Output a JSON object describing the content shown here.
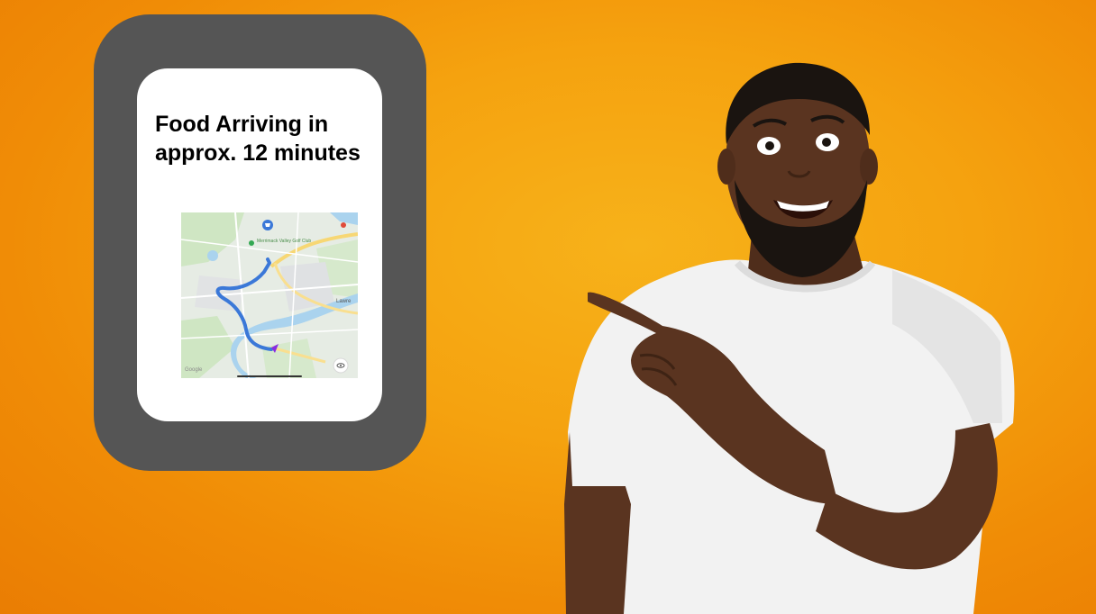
{
  "card": {
    "title": "Food Arriving in approx. 12 minutes"
  },
  "map": {
    "place_label": "Merrimack Valley Golf Club",
    "town_label": "Lawre",
    "watermark": "Google",
    "route_color": "#3b78d8",
    "vehicle_color": "#8a2be2"
  },
  "colors": {
    "background": "#f5a20f",
    "phone_frame": "#555555",
    "phone_screen": "#ffffff",
    "shirt": "#f2f2f2",
    "skin": "#5a3420"
  },
  "icons": {
    "vehicle": "delivery-vehicle-icon",
    "destination": "map-pin-icon",
    "recenter": "eye-icon"
  }
}
